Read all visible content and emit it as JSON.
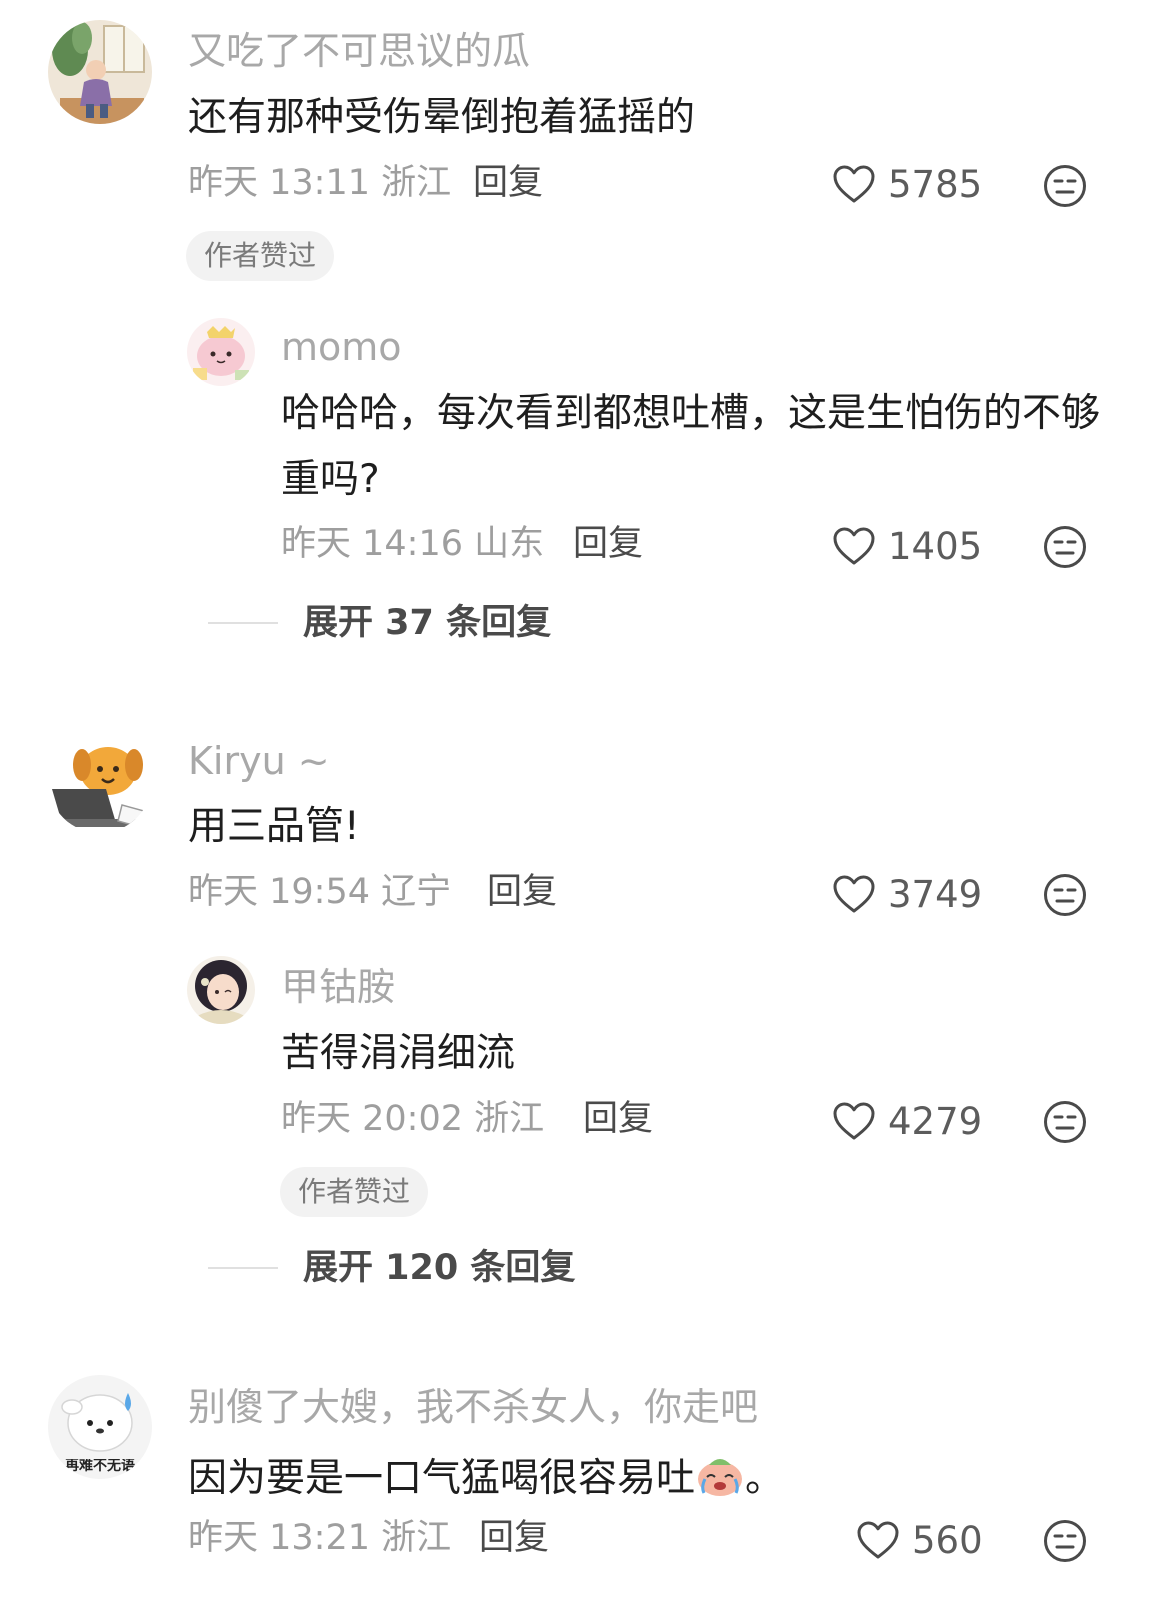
{
  "comments": [
    {
      "username": "又吃了不可思议的瓜",
      "text": "还有那种受伤晕倒抱着猛摇的",
      "time": "昨天 13:11 浙江",
      "reply_label": "回复",
      "likes": "5785",
      "badge": "作者赞过",
      "replies": [
        {
          "username": "momo",
          "text": "哈哈哈，每次看到都想吐槽，这是生怕伤的不够重吗?",
          "time": "昨天 14:16 山东",
          "reply_label": "回复",
          "likes": "1405"
        }
      ],
      "expand": "展开 37 条回复"
    },
    {
      "username": "Kiryu ~",
      "text": "用三品管!",
      "time": "昨天 19:54 辽宁",
      "reply_label": "回复",
      "likes": "3749",
      "replies": [
        {
          "username": "甲钴胺",
          "text": "苦得涓涓细流",
          "time": "昨天 20:02 浙江",
          "reply_label": "回复",
          "likes": "4279",
          "badge": "作者赞过"
        }
      ],
      "expand": "展开 120 条回复"
    },
    {
      "username": "别傻了大嫂，我不杀女人，你走吧",
      "text": "因为要是一口气猛喝很容易吐",
      "text_suffix": "。",
      "time": "昨天 13:21 浙江",
      "reply_label": "回复",
      "likes": "560",
      "avatar_caption": "再难不无语"
    }
  ]
}
